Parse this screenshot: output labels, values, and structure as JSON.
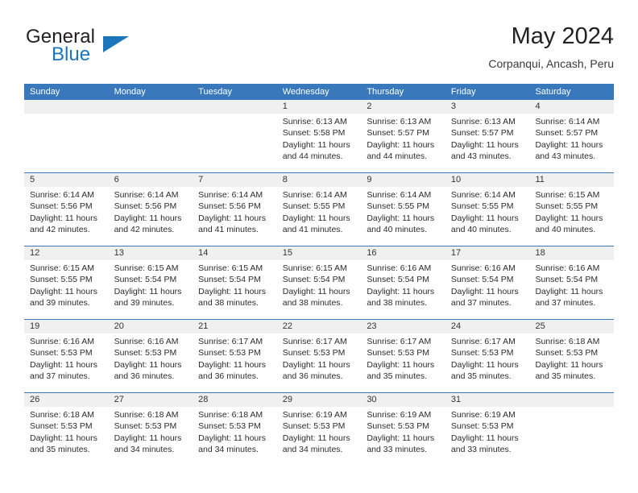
{
  "brand": {
    "word1": "General",
    "word2": "Blue",
    "accent": "#1b75bb",
    "logo_icon": "triangle-logo-icon"
  },
  "header": {
    "title": "May 2024",
    "subtitle": "Corpanqui, Ancash, Peru"
  },
  "calendar": {
    "header_color": "#3878bb",
    "weekdays": [
      "Sunday",
      "Monday",
      "Tuesday",
      "Wednesday",
      "Thursday",
      "Friday",
      "Saturday"
    ],
    "weeks": [
      [
        {
          "day": "",
          "sunrise": "",
          "sunset": "",
          "daylight1": "",
          "daylight2": "",
          "empty": true
        },
        {
          "day": "",
          "sunrise": "",
          "sunset": "",
          "daylight1": "",
          "daylight2": "",
          "empty": true
        },
        {
          "day": "",
          "sunrise": "",
          "sunset": "",
          "daylight1": "",
          "daylight2": "",
          "empty": true
        },
        {
          "day": "1",
          "sunrise": "Sunrise: 6:13 AM",
          "sunset": "Sunset: 5:58 PM",
          "daylight1": "Daylight: 11 hours",
          "daylight2": "and 44 minutes."
        },
        {
          "day": "2",
          "sunrise": "Sunrise: 6:13 AM",
          "sunset": "Sunset: 5:57 PM",
          "daylight1": "Daylight: 11 hours",
          "daylight2": "and 44 minutes."
        },
        {
          "day": "3",
          "sunrise": "Sunrise: 6:13 AM",
          "sunset": "Sunset: 5:57 PM",
          "daylight1": "Daylight: 11 hours",
          "daylight2": "and 43 minutes."
        },
        {
          "day": "4",
          "sunrise": "Sunrise: 6:14 AM",
          "sunset": "Sunset: 5:57 PM",
          "daylight1": "Daylight: 11 hours",
          "daylight2": "and 43 minutes."
        }
      ],
      [
        {
          "day": "5",
          "sunrise": "Sunrise: 6:14 AM",
          "sunset": "Sunset: 5:56 PM",
          "daylight1": "Daylight: 11 hours",
          "daylight2": "and 42 minutes."
        },
        {
          "day": "6",
          "sunrise": "Sunrise: 6:14 AM",
          "sunset": "Sunset: 5:56 PM",
          "daylight1": "Daylight: 11 hours",
          "daylight2": "and 42 minutes."
        },
        {
          "day": "7",
          "sunrise": "Sunrise: 6:14 AM",
          "sunset": "Sunset: 5:56 PM",
          "daylight1": "Daylight: 11 hours",
          "daylight2": "and 41 minutes."
        },
        {
          "day": "8",
          "sunrise": "Sunrise: 6:14 AM",
          "sunset": "Sunset: 5:55 PM",
          "daylight1": "Daylight: 11 hours",
          "daylight2": "and 41 minutes."
        },
        {
          "day": "9",
          "sunrise": "Sunrise: 6:14 AM",
          "sunset": "Sunset: 5:55 PM",
          "daylight1": "Daylight: 11 hours",
          "daylight2": "and 40 minutes."
        },
        {
          "day": "10",
          "sunrise": "Sunrise: 6:14 AM",
          "sunset": "Sunset: 5:55 PM",
          "daylight1": "Daylight: 11 hours",
          "daylight2": "and 40 minutes."
        },
        {
          "day": "11",
          "sunrise": "Sunrise: 6:15 AM",
          "sunset": "Sunset: 5:55 PM",
          "daylight1": "Daylight: 11 hours",
          "daylight2": "and 40 minutes."
        }
      ],
      [
        {
          "day": "12",
          "sunrise": "Sunrise: 6:15 AM",
          "sunset": "Sunset: 5:55 PM",
          "daylight1": "Daylight: 11 hours",
          "daylight2": "and 39 minutes."
        },
        {
          "day": "13",
          "sunrise": "Sunrise: 6:15 AM",
          "sunset": "Sunset: 5:54 PM",
          "daylight1": "Daylight: 11 hours",
          "daylight2": "and 39 minutes."
        },
        {
          "day": "14",
          "sunrise": "Sunrise: 6:15 AM",
          "sunset": "Sunset: 5:54 PM",
          "daylight1": "Daylight: 11 hours",
          "daylight2": "and 38 minutes."
        },
        {
          "day": "15",
          "sunrise": "Sunrise: 6:15 AM",
          "sunset": "Sunset: 5:54 PM",
          "daylight1": "Daylight: 11 hours",
          "daylight2": "and 38 minutes."
        },
        {
          "day": "16",
          "sunrise": "Sunrise: 6:16 AM",
          "sunset": "Sunset: 5:54 PM",
          "daylight1": "Daylight: 11 hours",
          "daylight2": "and 38 minutes."
        },
        {
          "day": "17",
          "sunrise": "Sunrise: 6:16 AM",
          "sunset": "Sunset: 5:54 PM",
          "daylight1": "Daylight: 11 hours",
          "daylight2": "and 37 minutes."
        },
        {
          "day": "18",
          "sunrise": "Sunrise: 6:16 AM",
          "sunset": "Sunset: 5:54 PM",
          "daylight1": "Daylight: 11 hours",
          "daylight2": "and 37 minutes."
        }
      ],
      [
        {
          "day": "19",
          "sunrise": "Sunrise: 6:16 AM",
          "sunset": "Sunset: 5:53 PM",
          "daylight1": "Daylight: 11 hours",
          "daylight2": "and 37 minutes."
        },
        {
          "day": "20",
          "sunrise": "Sunrise: 6:16 AM",
          "sunset": "Sunset: 5:53 PM",
          "daylight1": "Daylight: 11 hours",
          "daylight2": "and 36 minutes."
        },
        {
          "day": "21",
          "sunrise": "Sunrise: 6:17 AM",
          "sunset": "Sunset: 5:53 PM",
          "daylight1": "Daylight: 11 hours",
          "daylight2": "and 36 minutes."
        },
        {
          "day": "22",
          "sunrise": "Sunrise: 6:17 AM",
          "sunset": "Sunset: 5:53 PM",
          "daylight1": "Daylight: 11 hours",
          "daylight2": "and 36 minutes."
        },
        {
          "day": "23",
          "sunrise": "Sunrise: 6:17 AM",
          "sunset": "Sunset: 5:53 PM",
          "daylight1": "Daylight: 11 hours",
          "daylight2": "and 35 minutes."
        },
        {
          "day": "24",
          "sunrise": "Sunrise: 6:17 AM",
          "sunset": "Sunset: 5:53 PM",
          "daylight1": "Daylight: 11 hours",
          "daylight2": "and 35 minutes."
        },
        {
          "day": "25",
          "sunrise": "Sunrise: 6:18 AM",
          "sunset": "Sunset: 5:53 PM",
          "daylight1": "Daylight: 11 hours",
          "daylight2": "and 35 minutes."
        }
      ],
      [
        {
          "day": "26",
          "sunrise": "Sunrise: 6:18 AM",
          "sunset": "Sunset: 5:53 PM",
          "daylight1": "Daylight: 11 hours",
          "daylight2": "and 35 minutes."
        },
        {
          "day": "27",
          "sunrise": "Sunrise: 6:18 AM",
          "sunset": "Sunset: 5:53 PM",
          "daylight1": "Daylight: 11 hours",
          "daylight2": "and 34 minutes."
        },
        {
          "day": "28",
          "sunrise": "Sunrise: 6:18 AM",
          "sunset": "Sunset: 5:53 PM",
          "daylight1": "Daylight: 11 hours",
          "daylight2": "and 34 minutes."
        },
        {
          "day": "29",
          "sunrise": "Sunrise: 6:19 AM",
          "sunset": "Sunset: 5:53 PM",
          "daylight1": "Daylight: 11 hours",
          "daylight2": "and 34 minutes."
        },
        {
          "day": "30",
          "sunrise": "Sunrise: 6:19 AM",
          "sunset": "Sunset: 5:53 PM",
          "daylight1": "Daylight: 11 hours",
          "daylight2": "and 33 minutes."
        },
        {
          "day": "31",
          "sunrise": "Sunrise: 6:19 AM",
          "sunset": "Sunset: 5:53 PM",
          "daylight1": "Daylight: 11 hours",
          "daylight2": "and 33 minutes."
        },
        {
          "day": "",
          "sunrise": "",
          "sunset": "",
          "daylight1": "",
          "daylight2": "",
          "empty": true
        }
      ]
    ]
  }
}
